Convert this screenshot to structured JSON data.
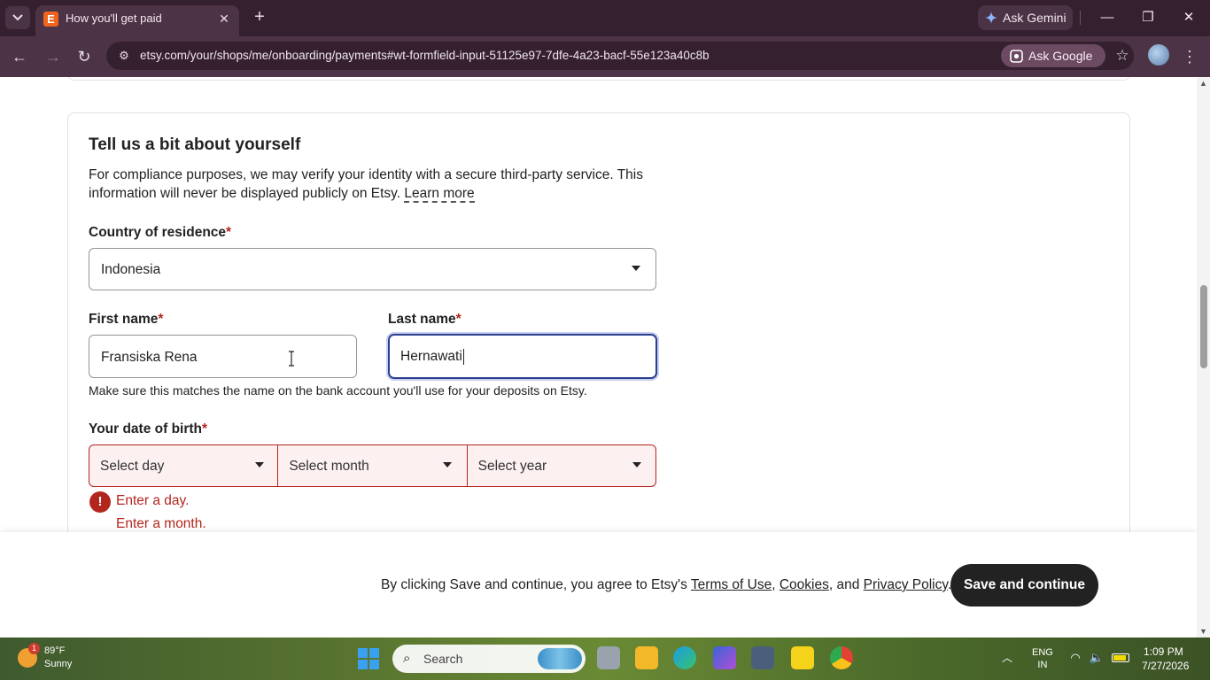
{
  "browser": {
    "tab_title": "How you'll get paid",
    "tab_favicon_letter": "E",
    "gemini_label": "Ask Gemini",
    "url": "etsy.com/your/shops/me/onboarding/payments#wt-formfield-input-51125e97-7dfe-4a23-bacf-55e123a40c8b",
    "ask_google_label": "Ask Google"
  },
  "form": {
    "title": "Tell us a bit about yourself",
    "description": "For compliance purposes, we may verify your identity with a secure third-party service. This information will never be displayed publicly on Etsy.",
    "learn_more": "Learn more",
    "country_label": "Country of residence",
    "country_value": "Indonesia",
    "first_name_label": "First name",
    "first_name_value": "Fransiska Rena",
    "last_name_label": "Last name",
    "last_name_value": "Hernawati",
    "name_hint": "Make sure this matches the name on the bank account you'll use for your deposits on Etsy.",
    "dob_label": "Your date of birth",
    "dob_day_placeholder": "Select day",
    "dob_month_placeholder": "Select month",
    "dob_year_placeholder": "Select year",
    "required_mark": "*",
    "errors": [
      "Enter a day.",
      "Enter a month."
    ]
  },
  "footer": {
    "agree_prefix": "By clicking Save and continue, you agree to Etsy's",
    "terms_link": "Terms of Use",
    "comma": ",",
    "cookies_link": "Cookies",
    "and_text": ", and",
    "privacy_link": "Privacy Policy",
    "period": ".",
    "save_button": "Save and continue"
  },
  "taskbar": {
    "weather_temp": "89°F",
    "weather_condition": "Sunny",
    "weather_badge": "1",
    "search_label": "Search",
    "lang_line1": "ENG",
    "lang_line2": "IN",
    "time": "1:09 PM",
    "date": "7/27/2026",
    "battery_level": 0.85
  },
  "icons": [
    "tab-list-icon",
    "close-icon",
    "plus-icon",
    "gemini-icon",
    "minimize-icon",
    "restore-icon",
    "back-icon",
    "forward-icon",
    "reload-icon",
    "site-info-icon",
    "lens-icon",
    "star-icon",
    "kebab-menu-icon",
    "dropdown-caret-icon",
    "error-icon",
    "windows-start-icon",
    "search-icon",
    "wifi-icon",
    "volume-icon",
    "battery-icon"
  ],
  "colors": {
    "chrome_dark": "#35202f",
    "chrome_toolbar": "#4d3346",
    "error_red": "#b3261e",
    "focus_blue": "#2c3e8f",
    "etsy_orange": "#f1641e",
    "button_dark": "#222222"
  }
}
